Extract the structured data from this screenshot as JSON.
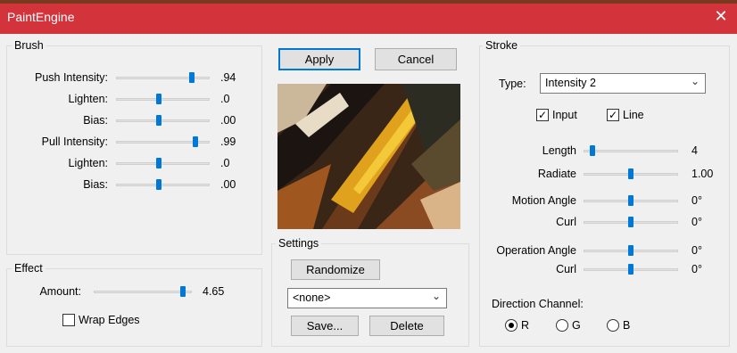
{
  "window": {
    "title": "PaintEngine"
  },
  "brush": {
    "label": "Brush",
    "sliders": [
      {
        "label": "Push Intensity:",
        "value": ".94",
        "level": 0.94
      },
      {
        "label": "Lighten:",
        "value": ".0",
        "level": 0.5
      },
      {
        "label": "Bias:",
        "value": ".00",
        "level": 0.5
      },
      {
        "label": "Pull Intensity:",
        "value": ".99",
        "level": 0.99
      },
      {
        "label": "Lighten:",
        "value": ".0",
        "level": 0.5
      },
      {
        "label": "Bias:",
        "value": ".00",
        "level": 0.5
      }
    ]
  },
  "effect": {
    "label": "Effect",
    "amount_label": "Amount:",
    "amount_value": "4.65",
    "amount_level": 0.97,
    "wrap_edges_label": "Wrap Edges",
    "wrap_edges_checked": false
  },
  "buttons": {
    "apply": "Apply",
    "cancel": "Cancel"
  },
  "settings": {
    "label": "Settings",
    "randomize": "Randomize",
    "preset_selected": "<none>",
    "save": "Save...",
    "delete": "Delete"
  },
  "stroke": {
    "label": "Stroke",
    "type_label": "Type:",
    "type_selected": "Intensity 2",
    "input_label": "Input",
    "input_checked": true,
    "line_label": "Line",
    "line_checked": true,
    "sliders": [
      {
        "label": "Length",
        "value": "4",
        "level": 0.05
      },
      {
        "label": "Radiate",
        "value": "1.00",
        "level": 0.5
      },
      {
        "label": "Motion Angle",
        "value": "0°",
        "level": 0.5
      },
      {
        "label": "Curl",
        "value": "0°",
        "level": 0.5
      },
      {
        "label": "Operation Angle",
        "value": "0°",
        "level": 0.5
      },
      {
        "label": "Curl",
        "value": "0°",
        "level": 0.5
      }
    ],
    "direction_label": "Direction Channel:",
    "channels": [
      {
        "label": "R",
        "selected": true
      },
      {
        "label": "G",
        "selected": false
      },
      {
        "label": "B",
        "selected": false
      }
    ]
  },
  "colors": {
    "titlebar": "#d3343b",
    "accent": "#0078d7"
  }
}
